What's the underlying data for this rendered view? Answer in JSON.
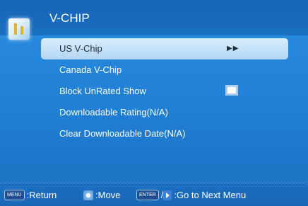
{
  "header": {
    "title": "V-CHIP"
  },
  "menu": {
    "items": [
      {
        "label": "US V-Chip",
        "arrows": "▶▶"
      },
      {
        "label": "Canada V-Chip"
      },
      {
        "label": "Block UnRated Show"
      },
      {
        "label": "Downloadable Rating(N/A)"
      },
      {
        "label": "Clear Downloadable Date(N/A)"
      }
    ]
  },
  "footer": {
    "menu_key": "MENU",
    "return_label": ":Return",
    "move_label": ":Move",
    "enter_key": "ENTER",
    "separator": "/",
    "next_label": ":Go to Next Menu"
  },
  "colors": {
    "background": "#1f7fd4",
    "selected": "#cfe6fb",
    "accent": "#e2b530"
  }
}
